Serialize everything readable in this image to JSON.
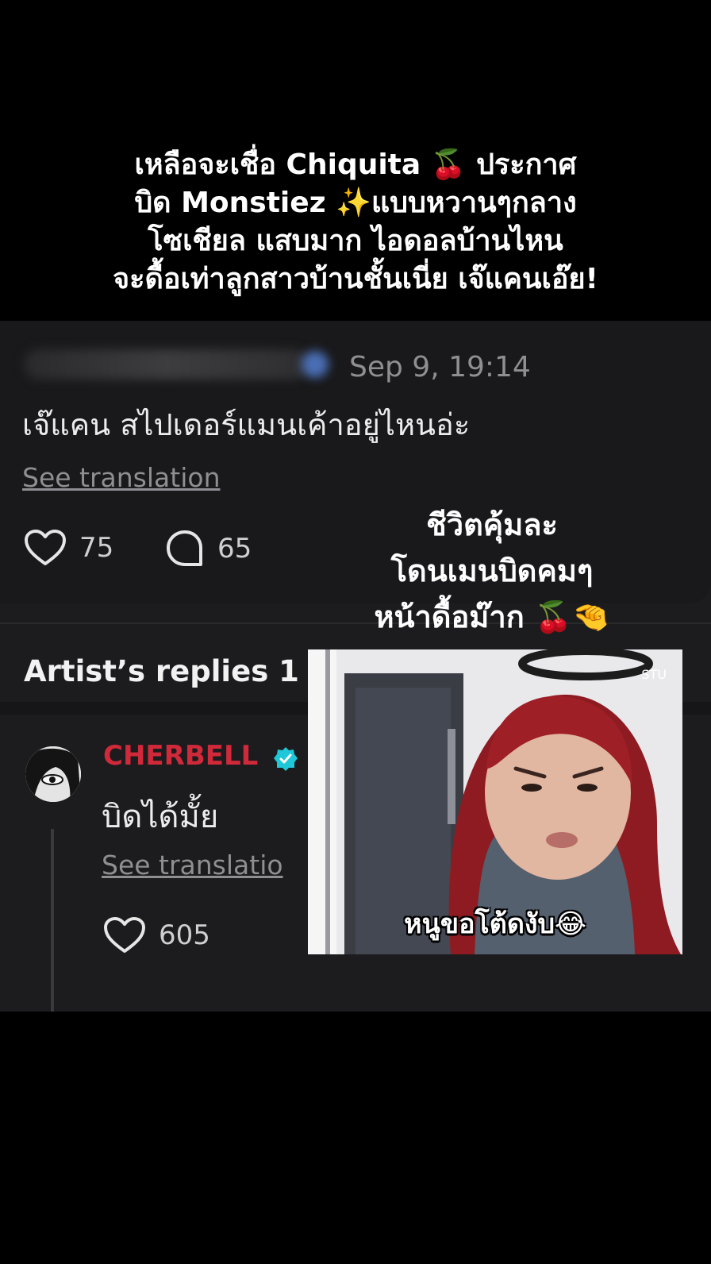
{
  "headline": {
    "lines": [
      "เหลือจะเชื่อ Chiquita 🍒 ประกาศ",
      "บิด Monstiez ✨แบบหวานๆกลาง",
      "โซเชียล แสบมาก ไอดอลบ้านไหน",
      "จะดื้อเท่าลูกสาวบ้านชั้นเนี่ย เจ๊แคนเอ๊ย!"
    ]
  },
  "post": {
    "date": "Sep 9, 19:14",
    "comment": "เจ๊แคน สไปเดอร์แมนเค้าอยู่ไหนอ่ะ",
    "see_translation": "See translation",
    "likes": "75",
    "replies": "65",
    "like_icon": "heart-icon",
    "comment_icon": "comment-bubble-icon"
  },
  "artist_replies": {
    "title": "Artist’s replies 1",
    "author": "CHERBELL",
    "author_color": "#d0293a",
    "verified_color": "#1ec8d8",
    "text": "บิดได้มั้ย",
    "see_translation": "See translatio",
    "likes": "605"
  },
  "overlay": {
    "lines": [
      "ชีวิตคุ้มละ",
      "โดนเมนบิดคมๆ",
      "หน้าดื้อม๊าก 🍒🤏"
    ],
    "photo_label": "STU",
    "photo_caption": "หนูขอโต้ดงับ😂"
  }
}
